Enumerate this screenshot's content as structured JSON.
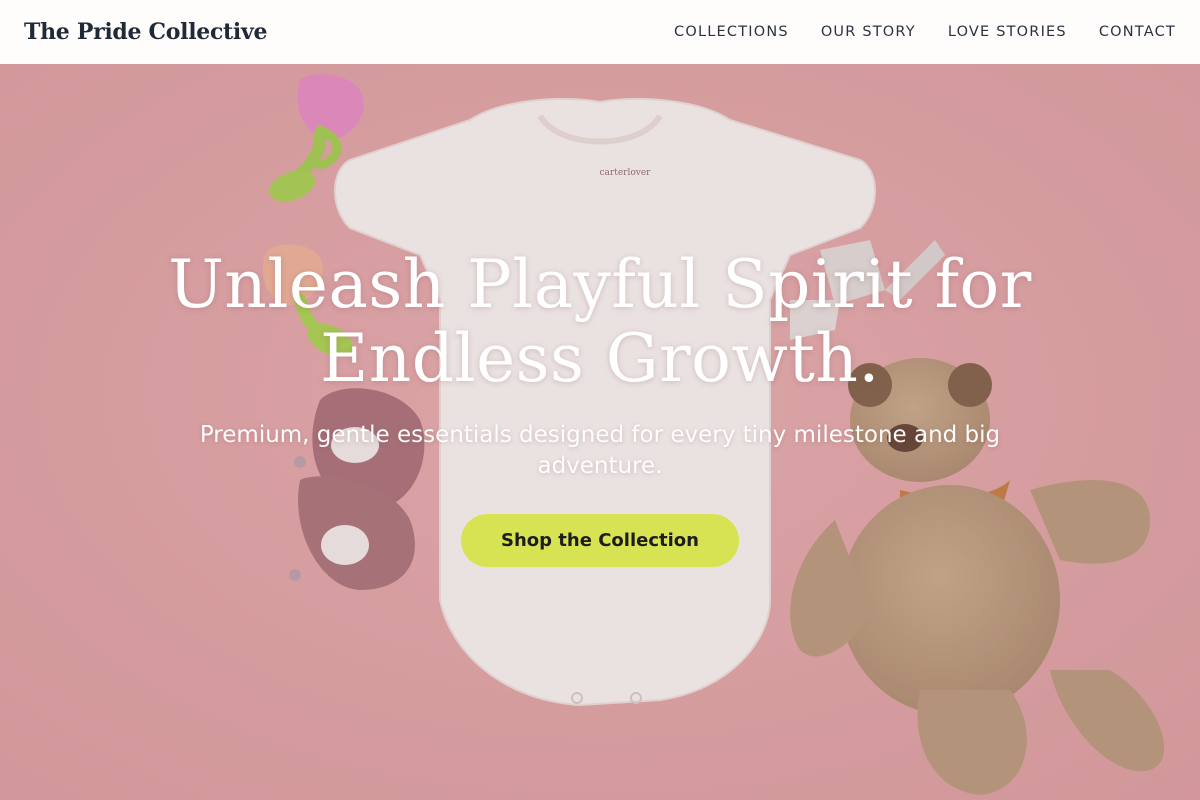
{
  "header": {
    "brand": "The Pride Collective",
    "nav": [
      {
        "label": "COLLECTIONS"
      },
      {
        "label": "OUR STORY"
      },
      {
        "label": "LOVE STORIES"
      },
      {
        "label": "CONTACT"
      }
    ]
  },
  "hero": {
    "headline_line1": "Unleash Playful Spirit for",
    "headline_line2": "Endless Growth.",
    "subheading": "Premium, gentle essentials designed for every tiny milestone and big adventure.",
    "cta_label": "Shop the Collection",
    "onesie_tag": "carterlover"
  },
  "colors": {
    "background": "#e8a7a7",
    "cta": "#d7e353",
    "brand": "#1f2a36"
  }
}
